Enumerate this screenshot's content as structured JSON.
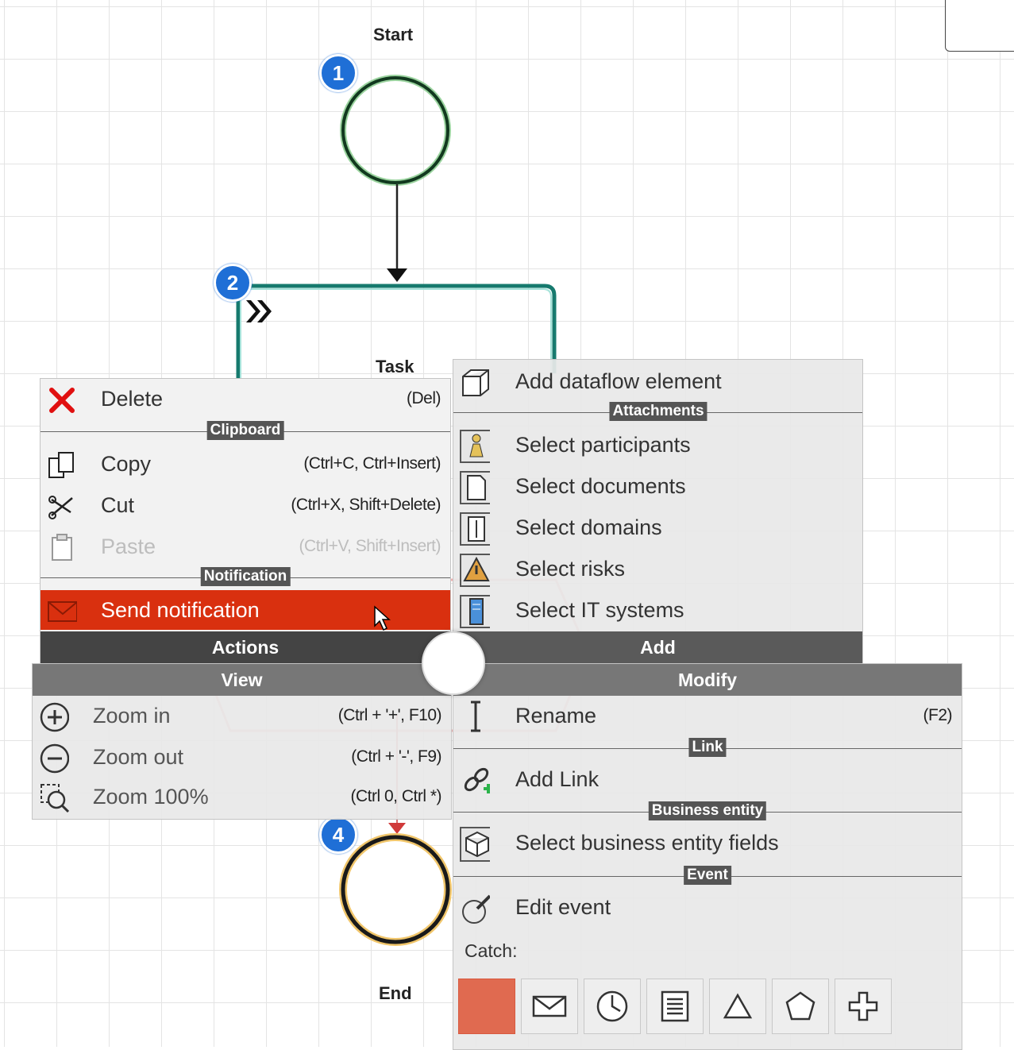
{
  "diagram": {
    "start_label": "Start",
    "task_label": "Task",
    "end_label": "End",
    "badges": [
      "1",
      "2",
      "4"
    ]
  },
  "actions_menu": {
    "delete": {
      "label": "Delete",
      "shortcut": "(Del)",
      "icon": "red-x-icon"
    },
    "clipboard_section": "Clipboard",
    "copy": {
      "label": "Copy",
      "shortcut": "(Ctrl+C, Ctrl+Insert)",
      "icon": "copy-icon"
    },
    "cut": {
      "label": "Cut",
      "shortcut": "(Ctrl+X, Shift+Delete)",
      "icon": "scissors-icon"
    },
    "paste": {
      "label": "Paste",
      "shortcut": "(Ctrl+V, Shift+Insert)",
      "icon": "clipboard-icon"
    },
    "notification_section": "Notification",
    "send_notification": {
      "label": "Send notification",
      "icon": "envelope-icon"
    },
    "header": "Actions"
  },
  "add_menu": {
    "dataflow": {
      "label": "Add dataflow element",
      "icon": "cube-icon"
    },
    "attachments_section": "Attachments",
    "participants": {
      "label": "Select participants",
      "icon": "participant-icon"
    },
    "documents": {
      "label": "Select documents",
      "icon": "document-icon"
    },
    "domains": {
      "label": "Select domains",
      "icon": "domain-icon"
    },
    "risks": {
      "label": "Select risks",
      "icon": "risk-icon"
    },
    "it_systems": {
      "label": "Select IT systems",
      "icon": "it-system-icon"
    },
    "header": "Add"
  },
  "view_menu": {
    "header": "View",
    "zoom_in": {
      "label": "Zoom in",
      "shortcut": "(Ctrl + '+', F10)",
      "icon": "zoom-in-icon"
    },
    "zoom_out": {
      "label": "Zoom out",
      "shortcut": "(Ctrl + '-', F9)",
      "icon": "zoom-out-icon"
    },
    "zoom_100": {
      "label": "Zoom 100%",
      "shortcut": "(Ctrl 0, Ctrl *)",
      "icon": "zoom-reset-icon"
    }
  },
  "modify_menu": {
    "header": "Modify",
    "rename": {
      "label": "Rename",
      "shortcut": "(F2)",
      "icon": "text-cursor-icon"
    },
    "link_section": "Link",
    "add_link": {
      "label": "Add Link",
      "icon": "link-icon"
    },
    "business_entity_section": "Business entity",
    "business_entity_fields": {
      "label": "Select business entity fields",
      "icon": "entity-icon"
    },
    "event_section": "Event",
    "edit_event": {
      "label": "Edit event",
      "icon": "edit-event-icon"
    },
    "catch_label": "Catch:",
    "catch_types": [
      "none",
      "message-icon",
      "timer-icon",
      "conditional-icon",
      "signal-icon",
      "multiple-icon",
      "parallel-icon"
    ]
  },
  "colors": {
    "highlight": "#d9300f",
    "badge": "#1f6fd6",
    "start_event": "#1b6b3a",
    "task_border": "#167a6e",
    "header_dark": "#444444",
    "header_mid": "#6e6e6e",
    "catch_selected": "#e06a50"
  }
}
